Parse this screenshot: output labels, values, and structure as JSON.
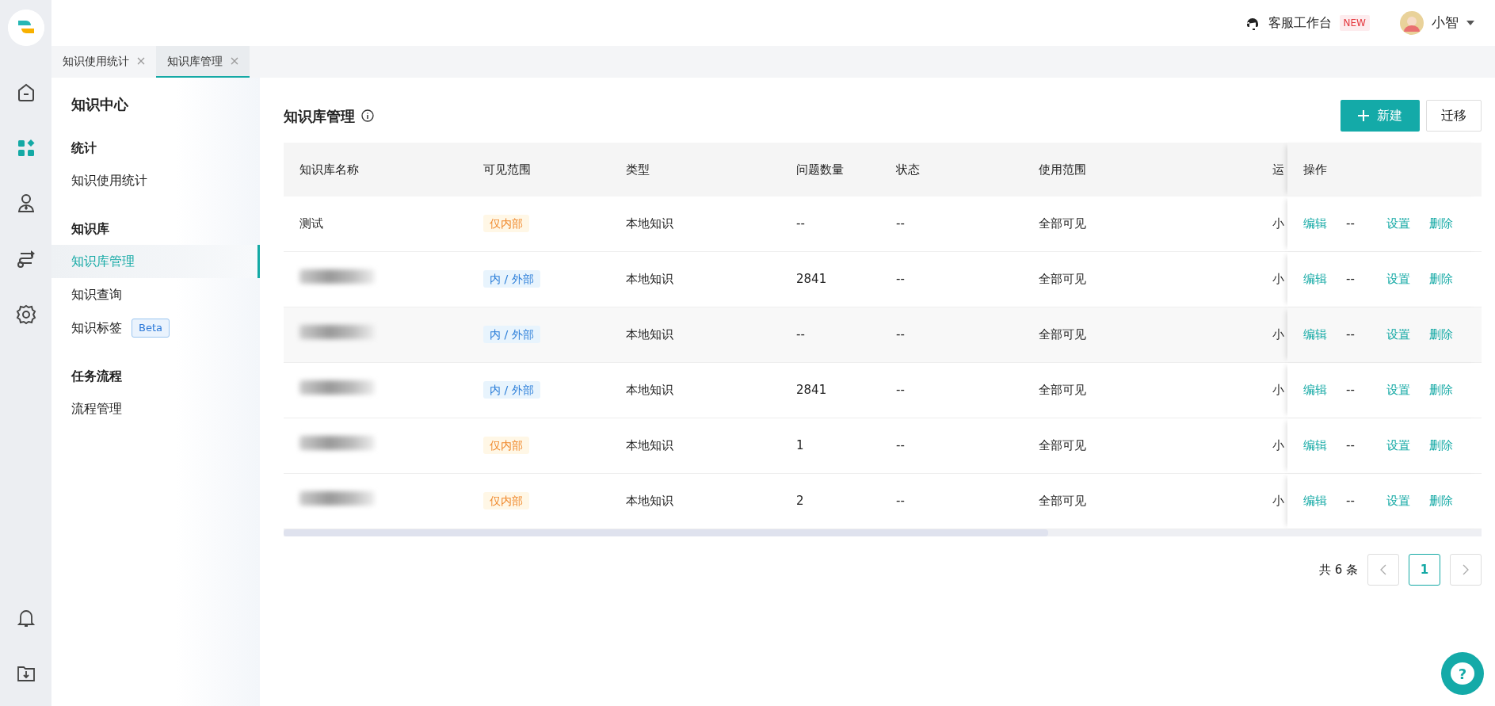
{
  "rail": {
    "items": [
      {
        "kind": "home",
        "selected": false
      },
      {
        "kind": "apps",
        "selected": true
      },
      {
        "kind": "person",
        "selected": false
      },
      {
        "kind": "flow",
        "selected": false
      },
      {
        "kind": "settings",
        "selected": false
      }
    ],
    "bottom_items": [
      {
        "kind": "bell"
      },
      {
        "kind": "download"
      }
    ]
  },
  "topbar": {
    "workbench": {
      "label": "客服工作台",
      "badge": "NEW"
    },
    "user": {
      "name": "小智"
    }
  },
  "tabs": [
    {
      "label": "知识使用统计",
      "selected": false
    },
    {
      "label": "知识库管理",
      "selected": true
    }
  ],
  "sidebar": {
    "title": "知识中心",
    "groups": [
      {
        "title": "统计",
        "items": [
          {
            "label": "知识使用统计",
            "selected": false
          }
        ]
      },
      {
        "title": "知识库",
        "items": [
          {
            "label": "知识库管理",
            "selected": true
          },
          {
            "label": "知识查询",
            "selected": false
          },
          {
            "label": "知识标签",
            "selected": false,
            "badge": "Beta"
          }
        ]
      },
      {
        "title": "任务流程",
        "items": [
          {
            "label": "流程管理",
            "selected": false
          }
        ]
      }
    ]
  },
  "page": {
    "title": "知识库管理",
    "buttons": [
      {
        "label": "新建",
        "kind": "primary"
      },
      {
        "label": "迁移",
        "kind": "default"
      }
    ]
  },
  "table": {
    "columns": [
      "知识库名称",
      "可见范围",
      "类型",
      "问题数量",
      "状态",
      "使用范围",
      "运",
      "操作"
    ],
    "rows": [
      {
        "name": "测试",
        "redacted": false,
        "highlighted": false,
        "visibility": {
          "label": "仅内部",
          "kind": "internal"
        },
        "type": "本地知识",
        "count": "--",
        "status": "--",
        "usage": "全部可见",
        "column_7": "小",
        "actions": [
          {
            "label": "编辑",
            "kind": "link"
          },
          {
            "label": "--",
            "kind": "text"
          },
          {
            "label": "设置",
            "kind": "link"
          },
          {
            "label": "删除",
            "kind": "link"
          }
        ]
      },
      {
        "redacted": true,
        "highlighted": false,
        "visibility": {
          "label": "内 / 外部",
          "kind": "both"
        },
        "type": "本地知识",
        "count": "2841",
        "status": "--",
        "usage": "全部可见",
        "column_7": "小",
        "actions": [
          {
            "label": "编辑",
            "kind": "link"
          },
          {
            "label": "--",
            "kind": "text"
          },
          {
            "label": "设置",
            "kind": "link"
          },
          {
            "label": "删除",
            "kind": "link"
          }
        ]
      },
      {
        "redacted": true,
        "highlighted": true,
        "visibility": {
          "label": "内 / 外部",
          "kind": "both"
        },
        "type": "本地知识",
        "count": "--",
        "status": "--",
        "usage": "全部可见",
        "column_7": "小",
        "actions": [
          {
            "label": "编辑",
            "kind": "link"
          },
          {
            "label": "--",
            "kind": "text"
          },
          {
            "label": "设置",
            "kind": "link"
          },
          {
            "label": "删除",
            "kind": "link"
          }
        ]
      },
      {
        "redacted": true,
        "highlighted": false,
        "visibility": {
          "label": "内 / 外部",
          "kind": "both"
        },
        "type": "本地知识",
        "count": "2841",
        "status": "--",
        "usage": "全部可见",
        "column_7": "小",
        "actions": [
          {
            "label": "编辑",
            "kind": "link"
          },
          {
            "label": "--",
            "kind": "text"
          },
          {
            "label": "设置",
            "kind": "link"
          },
          {
            "label": "删除",
            "kind": "link"
          }
        ]
      },
      {
        "redacted": true,
        "highlighted": false,
        "visibility": {
          "label": "仅内部",
          "kind": "internal"
        },
        "type": "本地知识",
        "count": "1",
        "status": "--",
        "usage": "全部可见",
        "column_7": "小",
        "actions": [
          {
            "label": "编辑",
            "kind": "link"
          },
          {
            "label": "--",
            "kind": "text"
          },
          {
            "label": "设置",
            "kind": "link"
          },
          {
            "label": "删除",
            "kind": "link"
          }
        ]
      },
      {
        "redacted": true,
        "highlighted": false,
        "visibility": {
          "label": "仅内部",
          "kind": "internal"
        },
        "type": "本地知识",
        "count": "2",
        "status": "--",
        "usage": "全部可见",
        "column_7": "小",
        "actions": [
          {
            "label": "编辑",
            "kind": "link"
          },
          {
            "label": "--",
            "kind": "text"
          },
          {
            "label": "设置",
            "kind": "link"
          },
          {
            "label": "删除",
            "kind": "link"
          }
        ]
      }
    ]
  },
  "pagination": {
    "total": "共 6 条",
    "pages": [
      {
        "label": "1",
        "selected": true
      }
    ]
  },
  "help_button": {
    "label": "?"
  }
}
